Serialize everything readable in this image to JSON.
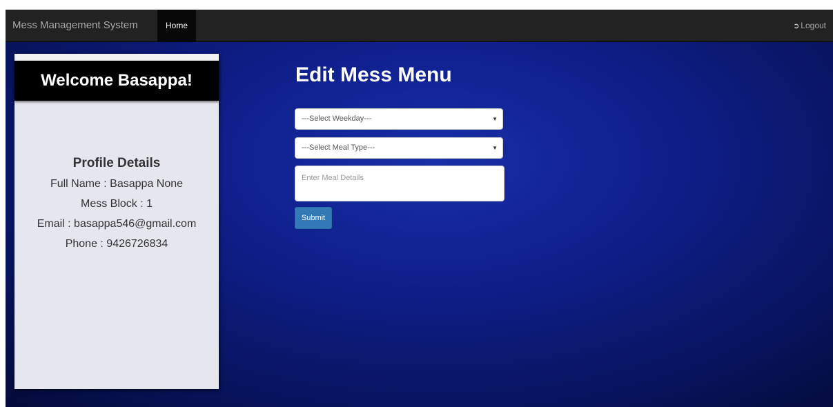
{
  "navbar": {
    "brand": "Mess Management System",
    "home_label": "Home",
    "logout_label": "Logout",
    "logout_icon": "log-out-icon"
  },
  "sidebar": {
    "welcome": "Welcome Basappa!",
    "profile_title": "Profile Details",
    "full_name": "Full Name : Basappa None",
    "mess_block": "Mess Block : 1",
    "email": "Email : basappa546@gmail.com",
    "phone": "Phone : 9426726834"
  },
  "main": {
    "title": "Edit Mess Menu",
    "weekday_select": "---Select Weekday---",
    "meal_type_select": "---Select Meal Type---",
    "meal_details_placeholder": "Enter Meal Details",
    "submit_label": "Submit"
  },
  "colors": {
    "navbar_bg": "#222222",
    "accent_button": "#337ab7",
    "background_blue": "#0f1f8c"
  }
}
